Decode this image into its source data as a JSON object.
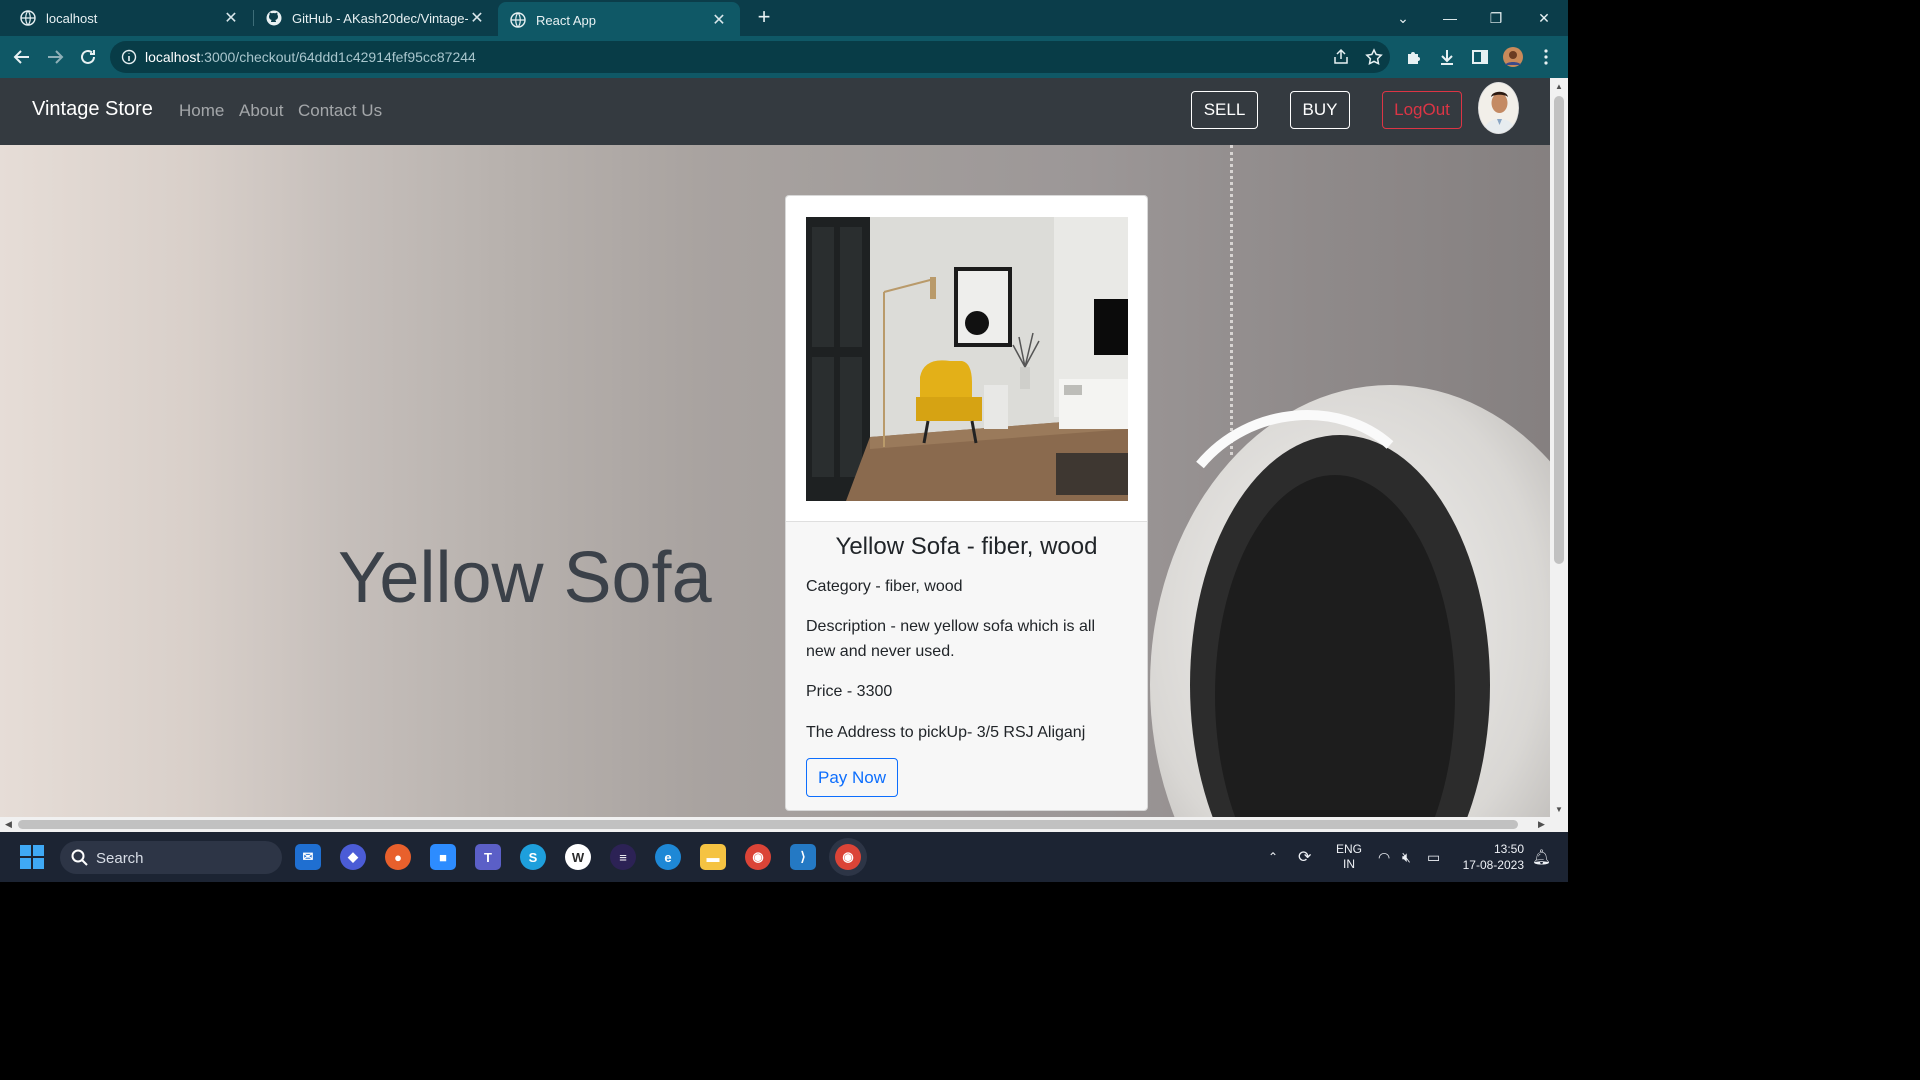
{
  "browser": {
    "tabs": [
      {
        "title": "localhost",
        "active": false
      },
      {
        "title": "GitHub - AKash20dec/Vintage-St",
        "active": false
      },
      {
        "title": "React App",
        "active": true
      }
    ],
    "url_host": "localhost",
    "url_rest": ":3000/checkout/64ddd1c42914fef95cc87244"
  },
  "navbar": {
    "brand": "Vintage Store",
    "links": [
      "Home",
      "About",
      "Contact Us"
    ],
    "sell": "SELL",
    "buy": "BUY",
    "logout": "LogOut"
  },
  "hero": {
    "title": "Yellow Sofa"
  },
  "card": {
    "title": "Yellow Sofa - fiber, wood",
    "category": "Category - fiber, wood",
    "description": "Description - new yellow sofa which is all new and never used.",
    "price": "Price - 3300",
    "address": "The Address to pickUp- 3/5 RSJ Aliganj",
    "pay_button": "Pay Now"
  },
  "taskbar": {
    "search_label": "Search",
    "lang_top": "ENG",
    "lang_bottom": "IN",
    "time": "13:50",
    "date": "17-08-2023"
  },
  "colors": {
    "navbar_bg": "#343a40",
    "primary": "#0d6efd",
    "danger": "#dc3545",
    "chrome_bg": "#0f5866"
  }
}
